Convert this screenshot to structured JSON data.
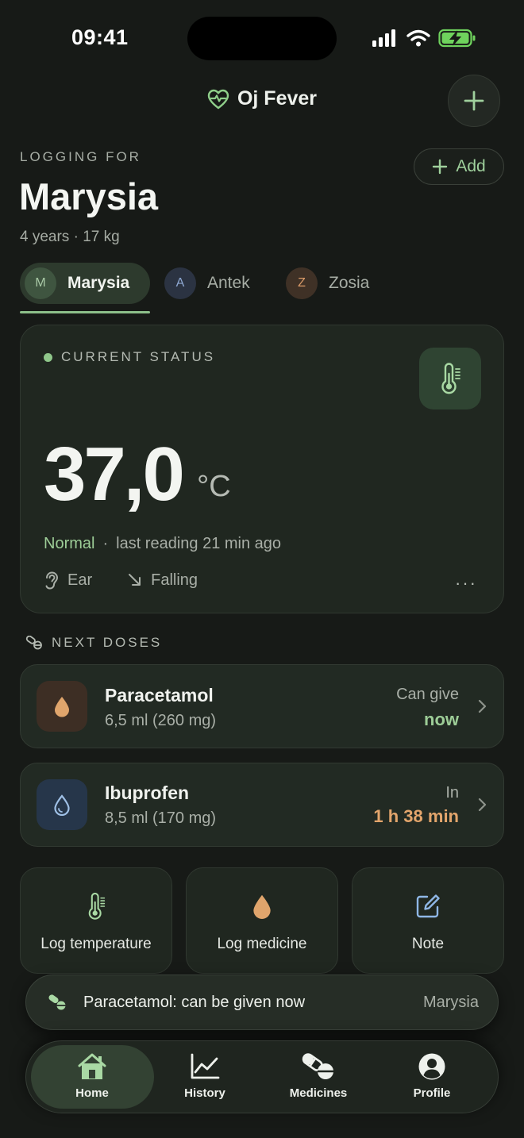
{
  "status_bar": {
    "time": "09:41"
  },
  "header": {
    "app_name": "Oj Fever",
    "logo_icon": "heart-pulse-icon",
    "new_icon": "plus-icon"
  },
  "child": {
    "section_label": "LOGGING FOR",
    "name": "Marysia",
    "meta": "4 years · 17 kg",
    "add_label": "Add"
  },
  "children_tabs": [
    {
      "initial": "M",
      "name": "Marysia",
      "active": true,
      "color": "#5b8a58"
    },
    {
      "initial": "A",
      "name": "Antek",
      "active": false,
      "color": "#6d8fc4"
    },
    {
      "initial": "Z",
      "name": "Zosia",
      "active": false,
      "color": "#c98a58"
    }
  ],
  "current_status": {
    "label": "CURRENT STATUS",
    "temperature": "37,0",
    "unit": "°C",
    "state": "Normal",
    "separator": "·",
    "last_reading": "last reading 21 min ago",
    "method": "Ear",
    "trend": "Falling",
    "more": "···"
  },
  "next_doses": {
    "label": "NEXT DOSES",
    "items": [
      {
        "name": "Paracetamol",
        "amount": "6,5 ml (260 mg)",
        "when_label": "Can give",
        "when_value": "now",
        "accent": "#9dcd97",
        "icon": "drop-icon",
        "icon_bg": "#3d2e24",
        "icon_color": "#e0a56c"
      },
      {
        "name": "Ibuprofen",
        "amount": "8,5 ml (170 mg)",
        "when_label": "In",
        "when_value": "1 h 38 min",
        "accent": "#e3a56c",
        "icon": "drop-outline-icon",
        "icon_bg": "#26364a",
        "icon_color": "#9fc0e6"
      }
    ]
  },
  "actions": [
    {
      "label": "Log temperature",
      "icon": "thermometer-icon"
    },
    {
      "label": "Log medicine",
      "icon": "drop-icon"
    },
    {
      "label": "Note",
      "icon": "edit-icon"
    }
  ],
  "toast": {
    "message": "Paracetamol: can be given now",
    "child": "Marysia"
  },
  "tabbar": [
    {
      "label": "Home",
      "icon": "home-icon",
      "active": true
    },
    {
      "label": "History",
      "icon": "chart-icon",
      "active": false
    },
    {
      "label": "Medicines",
      "icon": "pills-icon",
      "active": false
    },
    {
      "label": "Profile",
      "icon": "profile-icon",
      "active": false
    }
  ]
}
